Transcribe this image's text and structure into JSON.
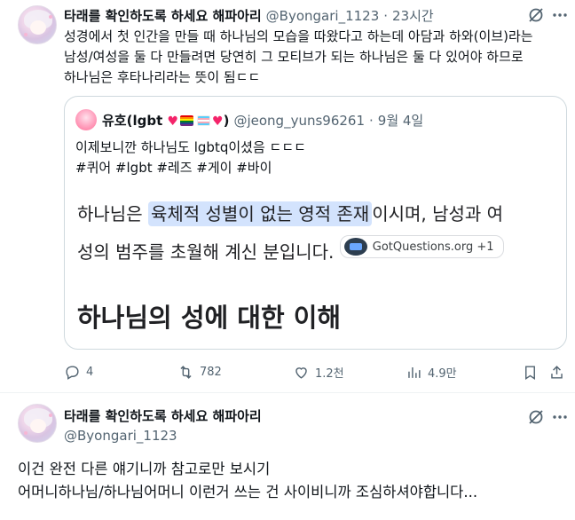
{
  "tweet1": {
    "display_name": "타래를 확인하도록 하세요 해파아리",
    "handle": "@Byongari_1123",
    "separator": "·",
    "time": "23시간",
    "lines": [
      "성경에서 첫 인간을 만들 때 하나님의 모습을 따왔다고 하는데 아담과 하와(이브)라는",
      "남성/여성을 둘 다 만들려면 당연히 그 모티브가 되는 하나님은 둘 다 있어야 하므로",
      "하나님은 후타나리라는 뜻이 됨ㄷㄷ"
    ],
    "icons": {
      "grok": "grok-icon",
      "more": "more-icon"
    }
  },
  "quote": {
    "display_name_prefix": "유호(lgbt",
    "display_name_suffix": ")",
    "name_emojis": [
      "heart-icon",
      "rainbow-flag-icon",
      "trans-flag-icon",
      "heart-icon"
    ],
    "handle": "@jeong_yuns96261",
    "separator": "·",
    "date": "9월 4일",
    "line1": "이제보니깐 하나님도 lgbtq이셨음 ㄷㄷㄷ",
    "line2": "#퀴어 #lgbt #레즈 #게이 #바이",
    "snippet": {
      "pre": "하나님은",
      "highlight": "육체적 성별이 없는 영적 존재",
      "post": "이시며, 남성과 여",
      "line2": "성의 범주를 초월해 계신 분입니다.",
      "chip": "GotQuestions.org +1"
    },
    "heading": "하나님의 성에 대한 이해"
  },
  "actions": {
    "reply": "4",
    "retweet": "782",
    "like": "1.2천",
    "views": "4.9만"
  },
  "tweet2": {
    "display_name": "타래를 확인하도록 하세요 해파아리",
    "handle": "@Byongari_1123",
    "lines": [
      "이건 완전 다른 얘기니까 참고로만 보시기",
      "어머니하나님/하나님어머니 이런거 쓰는 건 사이비니까 조심하셔야합니다..."
    ]
  }
}
